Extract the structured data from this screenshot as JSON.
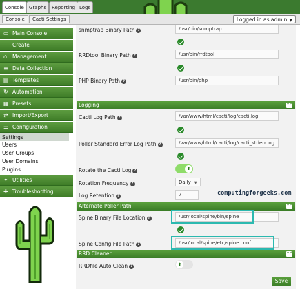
{
  "top_tabs": [
    "Console",
    "Graphs",
    "Reporting",
    "Logs"
  ],
  "breadcrumb": [
    "Console",
    "Cacti Settings"
  ],
  "login": "Logged in as admin",
  "sidebar": {
    "items_top": [
      {
        "label": "Main Console",
        "icon": "desktop-icon"
      },
      {
        "label": "Create",
        "icon": "plus-icon"
      },
      {
        "label": "Management",
        "icon": "home-icon"
      },
      {
        "label": "Data Collection",
        "icon": "database-icon"
      },
      {
        "label": "Templates",
        "icon": "templates-icon"
      },
      {
        "label": "Automation",
        "icon": "automation-icon"
      },
      {
        "label": "Presets",
        "icon": "presets-icon"
      },
      {
        "label": "Import/Export",
        "icon": "import-export-icon"
      },
      {
        "label": "Configuration",
        "icon": "sliders-icon"
      }
    ],
    "sub_items": [
      "Settings",
      "Users",
      "User Groups",
      "User Domains",
      "Plugins"
    ],
    "items_bottom": [
      {
        "label": "Utilities",
        "icon": "utilities-icon"
      },
      {
        "label": "Troubleshooting",
        "icon": "troubleshooting-icon"
      }
    ]
  },
  "main": {
    "snmptrap_label": "snmptrap Binary Path",
    "snmptrap_value": "/usr/bin/snmptrap",
    "rrdtool_label": "RRDtool Binary Path",
    "rrdtool_value": "/usr/bin/rrdtool",
    "php_label": "PHP Binary Path",
    "php_value": "/usr/bin/php",
    "logging_section": "Logging",
    "cacti_log_label": "Cacti Log Path",
    "cacti_log_value": "/var/www/html/cacti/log/cacti.log",
    "poller_log_label": "Poller Standard Error Log Path",
    "poller_log_value": "/var/www/html/cacti/log/cacti_stderr.log",
    "rotate_label": "Rotate the Cacti Log",
    "rotate_on": true,
    "rotation_freq_label": "Rotation Frequency",
    "rotation_freq_value": "Daily",
    "log_retention_label": "Log Retention",
    "log_retention_value": "7",
    "alt_poller_section": "Alternate Poller Path",
    "spine_bin_label": "Spine Binary File Location",
    "spine_bin_value": "/usr/local/spine/bin/spine",
    "spine_conf_label": "Spine Config File Path",
    "spine_conf_value": "/usr/local/spine/etc/spine.conf",
    "rrd_cleaner_section": "RRD Cleaner",
    "rrdfile_clean_label": "RRDfile Auto Clean",
    "rrdfile_clean_on": false,
    "watermark": "computingforgeeks.com",
    "save_label": "Save"
  },
  "colors": {
    "accent": "#3b7d27",
    "highlight": "#2cb9b0"
  }
}
